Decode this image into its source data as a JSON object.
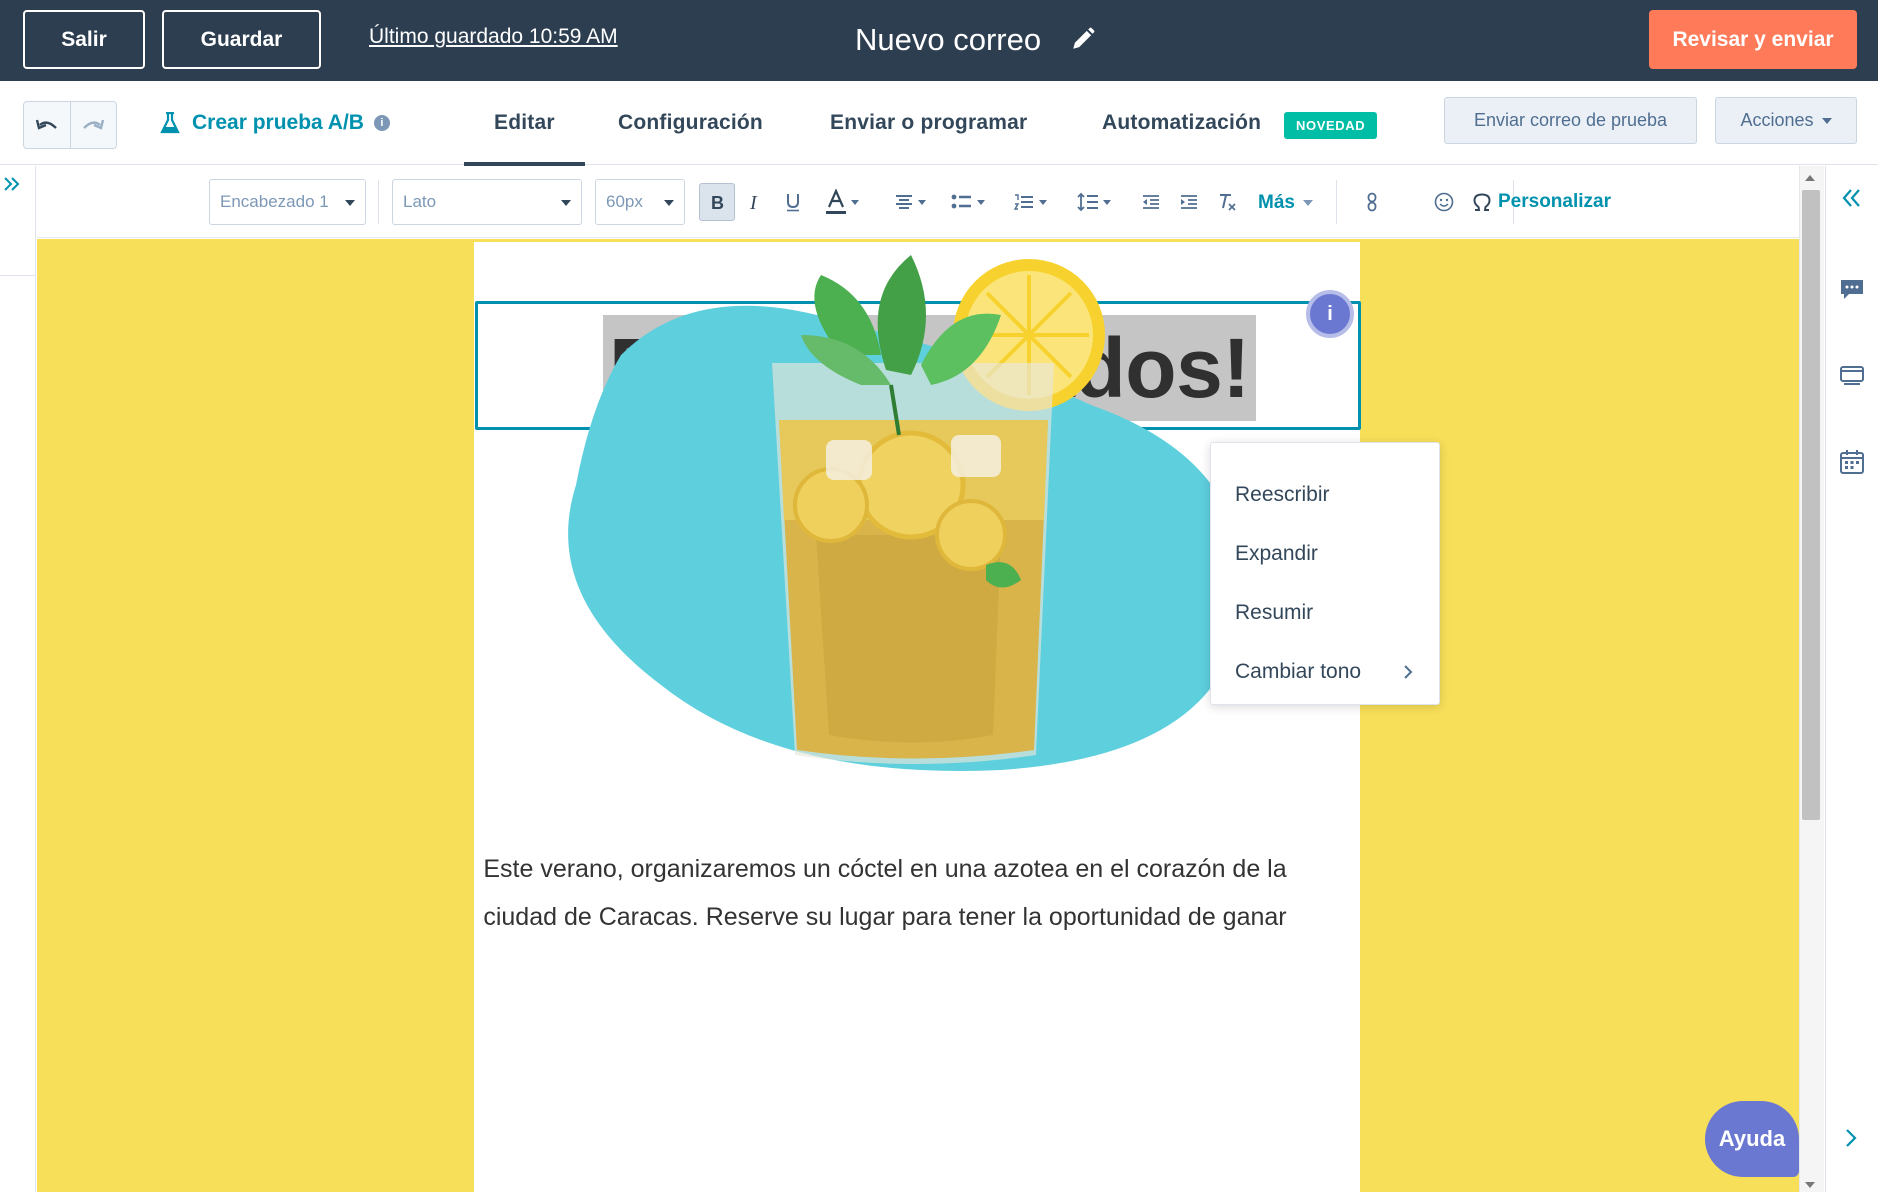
{
  "topbar": {
    "exit_label": "Salir",
    "save_label": "Guardar",
    "last_saved": "Último guardado 10:59 AM",
    "title": "Nuevo correo",
    "review_label": "Revisar y enviar"
  },
  "navbar": {
    "ab_test_label": "Crear prueba A/B",
    "tabs": [
      {
        "label": "Editar",
        "active": true
      },
      {
        "label": "Configuración",
        "active": false
      },
      {
        "label": "Enviar o programar",
        "active": false
      },
      {
        "label": "Automatización",
        "active": false
      }
    ],
    "new_badge": "NOVEDAD",
    "test_email_label": "Enviar correo de prueba",
    "actions_label": "Acciones"
  },
  "toolbar": {
    "style_select": "Encabezado 1",
    "font_select": "Lato",
    "size_select": "60px",
    "more_label": "Más",
    "personalize_label": "Personalizar"
  },
  "email": {
    "heading": "Están invitados!",
    "info_badge": "i",
    "body_line1": "Este verano, organizaremos un cóctel en una azotea en el corazón de la",
    "body_line2": "ciudad de Caracas. Reserve su lugar para tener la oportunidad de ganar"
  },
  "context_menu": {
    "items": [
      "Reescribir",
      "Expandir",
      "Resumir",
      "Cambiar tono"
    ]
  },
  "help_label": "Ayuda",
  "colors": {
    "topbar_bg": "#2d3e50",
    "accent_orange": "#ff7a59",
    "link_teal": "#0091ae",
    "badge_green": "#00bda5",
    "canvas_yellow": "#f7df59",
    "blob_cyan": "#5ecfdd",
    "help_purple": "#6a78d1"
  }
}
